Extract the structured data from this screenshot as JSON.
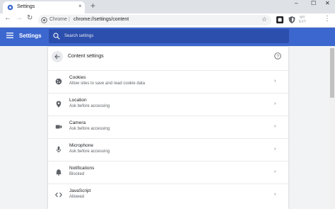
{
  "tab": {
    "title": "Settings",
    "close": "×"
  },
  "new_tab": "+",
  "window": {
    "min": "–",
    "max": "☐",
    "close": "✕"
  },
  "toolbar": {
    "back": "←",
    "forward": "→",
    "reload": "↻",
    "site_chip": "Chrome",
    "separator": "|",
    "url": "chrome://settings/content",
    "star": "☆",
    "ext3_text": "MY\nEXT",
    "menu": "⋮"
  },
  "header": {
    "title": "Settings",
    "search_placeholder": "Search settings"
  },
  "content": {
    "title": "Content settings",
    "rows": [
      {
        "title": "Cookies",
        "subtitle": "Allow sites to save and read cookie data",
        "icon": "cookie-icon"
      },
      {
        "title": "Location",
        "subtitle": "Ask before accessing",
        "icon": "location-icon"
      },
      {
        "title": "Camera",
        "subtitle": "Ask before accessing",
        "icon": "camera-icon"
      },
      {
        "title": "Microphone",
        "subtitle": "Ask before accessing",
        "icon": "microphone-icon"
      },
      {
        "title": "Notifications",
        "subtitle": "Blocked",
        "icon": "bell-icon"
      },
      {
        "title": "JavaScript",
        "subtitle": "Allowed",
        "icon": "code-icon"
      }
    ],
    "arrow": "›"
  },
  "colors": {
    "header_blue": "#3c67cf",
    "search_blue": "#2c4fae",
    "tab_strip": "#dee1e6",
    "page_bg": "#f1f3f4"
  }
}
